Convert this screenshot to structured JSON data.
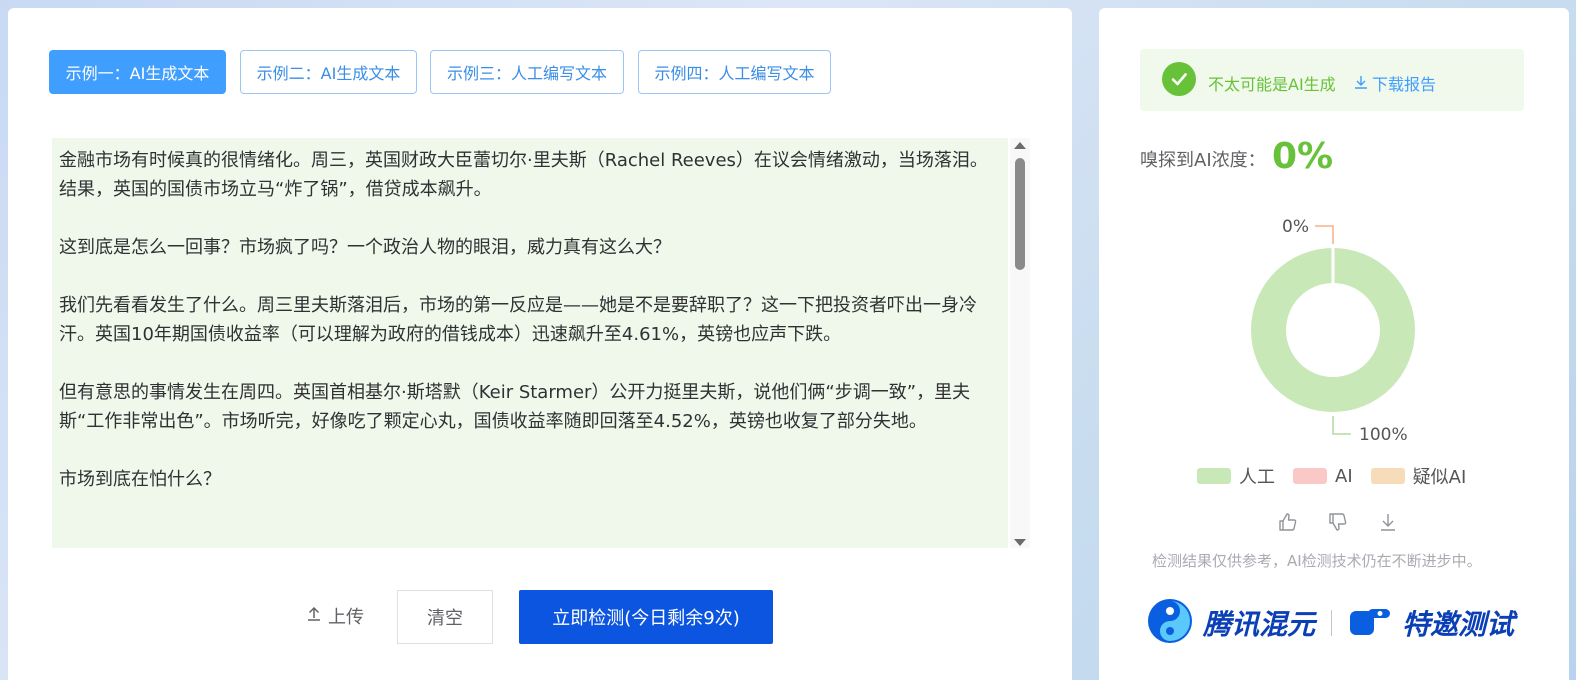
{
  "tabs": [
    {
      "label": "示例一：AI生成文本",
      "active": true
    },
    {
      "label": "示例二：AI生成文本",
      "active": false
    },
    {
      "label": "示例三：人工编写文本",
      "active": false
    },
    {
      "label": "示例四：人工编写文本",
      "active": false
    }
  ],
  "article": {
    "paragraphs": [
      "金融市场有时候真的很情绪化。周三，英国财政大臣蕾切尔·里夫斯（Rachel Reeves）在议会情绪激动，当场落泪。结果，英国的国债市场立马“炸了锅”，借贷成本飙升。",
      "这到底是怎么一回事？市场疯了吗？一个政治人物的眼泪，威力真有这么大？",
      "我们先看看发生了什么。周三里夫斯落泪后，市场的第一反应是——她是不是要辞职了？这一下把投资者吓出一身冷汗。英国10年期国债收益率（可以理解为政府的借钱成本）迅速飙升至4.61%，英镑也应声下跌。",
      "但有意思的事情发生在周四。英国首相基尔·斯塔默（Keir Starmer）公开力挺里夫斯，说他们俩“步调一致”，里夫斯“工作非常出色”。市场听完，好像吃了颗定心丸，国债收益率随即回落至4.52%，英镑也收复了部分失地。",
      "市场到底在怕什么？"
    ]
  },
  "actions": {
    "upload_label": "上传",
    "clear_label": "清空",
    "detect_label": "立即检测(今日剩余9次)"
  },
  "result": {
    "verdict": "不太可能是AI生成",
    "download_label": "下载报告",
    "ai_label": "嗅探到AI浓度：",
    "ai_value": "0%"
  },
  "chart_data": {
    "type": "pie",
    "variant": "donut",
    "categories": [
      "人工",
      "AI",
      "疑似AI"
    ],
    "values": [
      100,
      0,
      0
    ],
    "data_labels": [
      "100%",
      "0%"
    ],
    "colors": [
      "#c8e8b7",
      "#fbc8c8",
      "#f6dcb8"
    ],
    "legend": "bottom"
  },
  "legend": [
    {
      "label": "人工",
      "color": "#c8e8b7"
    },
    {
      "label": "AI",
      "color": "#fbc8c8"
    },
    {
      "label": "疑似AI",
      "color": "#f6dcb8"
    }
  ],
  "disclaimer": "检测结果仅供参考，AI检测技术仍在不断进步中。",
  "branding": {
    "brand": "腾讯混元",
    "badge": "特邀测试"
  },
  "icons": {
    "check": "check-circle-icon",
    "download": "download-icon",
    "upload": "upload-icon",
    "like": "thumbs-up-icon",
    "dislike": "thumbs-down-icon"
  }
}
